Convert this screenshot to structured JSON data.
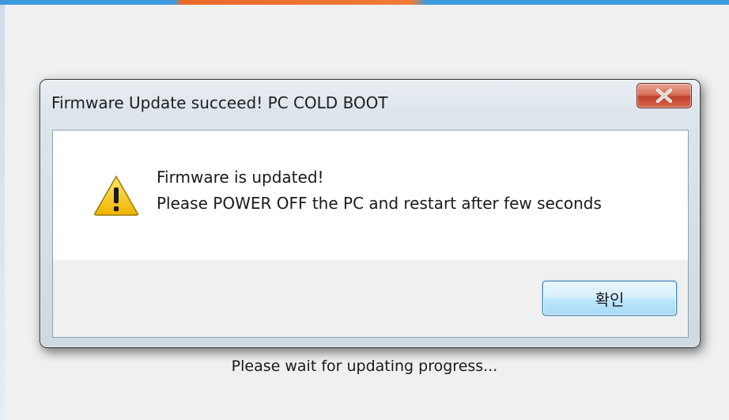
{
  "background": {
    "status_text": "Please wait for updating progress..."
  },
  "dialog": {
    "title": "Firmware Update succeed! PC COLD BOOT",
    "close_icon": "close-x-icon",
    "message_icon": "warning-triangle-icon",
    "message_line1": "Firmware is updated!",
    "message_line2": "Please POWER OFF the PC and restart after few seconds",
    "ok_label": "확인"
  },
  "colors": {
    "close_button": "#c0412c",
    "ok_button_border": "#3c7fb1",
    "warning_yellow": "#f5c400"
  }
}
